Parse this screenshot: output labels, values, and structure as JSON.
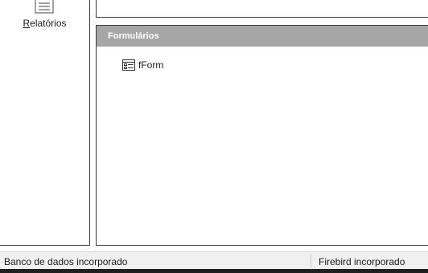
{
  "nav": {
    "reports": {
      "label_accel": "R",
      "label_rest": "elatórios",
      "icon": "report-icon"
    }
  },
  "forms": {
    "title": "Formulários",
    "items": [
      {
        "name": "fForm",
        "icon": "form-icon"
      }
    ]
  },
  "statusbar": {
    "left": "Banco de dados incorporado",
    "right": "Firebird incorporado"
  }
}
